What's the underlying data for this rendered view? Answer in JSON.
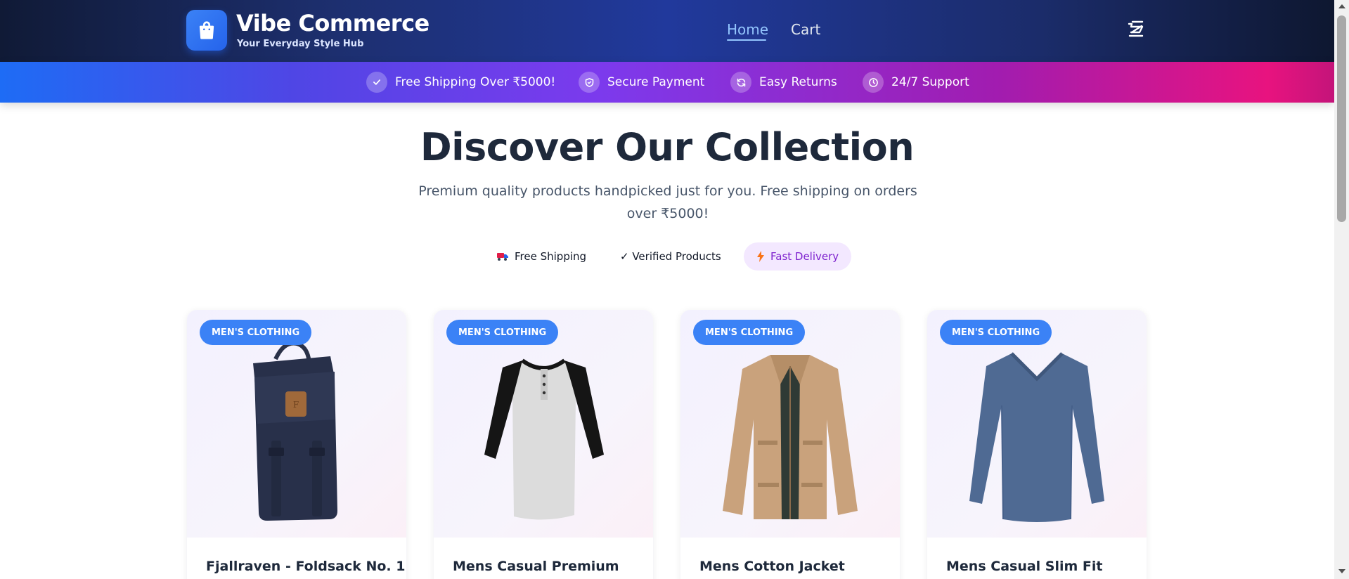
{
  "header": {
    "brand_title": "Vibe Commerce",
    "brand_tagline": "Your Everyday Style Hub",
    "logo_icon": "shopping-bag-icon",
    "nav": [
      {
        "label": "Home",
        "active": true
      },
      {
        "label": "Cart",
        "active": false
      }
    ],
    "cart_icon": "shopping-cart-icon"
  },
  "benefits": [
    {
      "icon": "check-icon",
      "label": "Free Shipping Over ₹5000!"
    },
    {
      "icon": "shield-icon",
      "label": "Secure Payment"
    },
    {
      "icon": "refresh-icon",
      "label": "Easy Returns"
    },
    {
      "icon": "clock-icon",
      "label": "24/7 Support"
    }
  ],
  "hero": {
    "title": "Discover Our Collection",
    "subtitle": "Premium quality products handpicked just for you. Free shipping on orders over ₹5000!",
    "chips": [
      {
        "icon": "truck-emoji",
        "label": "Free Shipping"
      },
      {
        "icon": "checkmark",
        "label": "✓ Verified Products"
      },
      {
        "icon": "lightning-icon",
        "label": "Fast Delivery",
        "highlighted": true
      }
    ]
  },
  "products": [
    {
      "category": "MEN'S CLOTHING",
      "title": "Fjallraven - Foldsack No. 1",
      "image": "backpack"
    },
    {
      "category": "MEN'S CLOTHING",
      "title": "Mens Casual Premium",
      "image": "raglan-tshirt"
    },
    {
      "category": "MEN'S CLOTHING",
      "title": "Mens Cotton Jacket",
      "image": "cotton-jacket"
    },
    {
      "category": "MEN'S CLOTHING",
      "title": "Mens Casual Slim Fit",
      "image": "long-sleeve-tee"
    }
  ],
  "colors": {
    "header_bg": "#1d2f6f",
    "accent_blue": "#3b82f6",
    "nav_active": "#93c5fd",
    "benefits_gradient_start": "#1e6cf5",
    "benefits_gradient_end": "#e8137f",
    "chip_highlight_bg": "#f3e8ff",
    "chip_highlight_text": "#7e22ce"
  }
}
